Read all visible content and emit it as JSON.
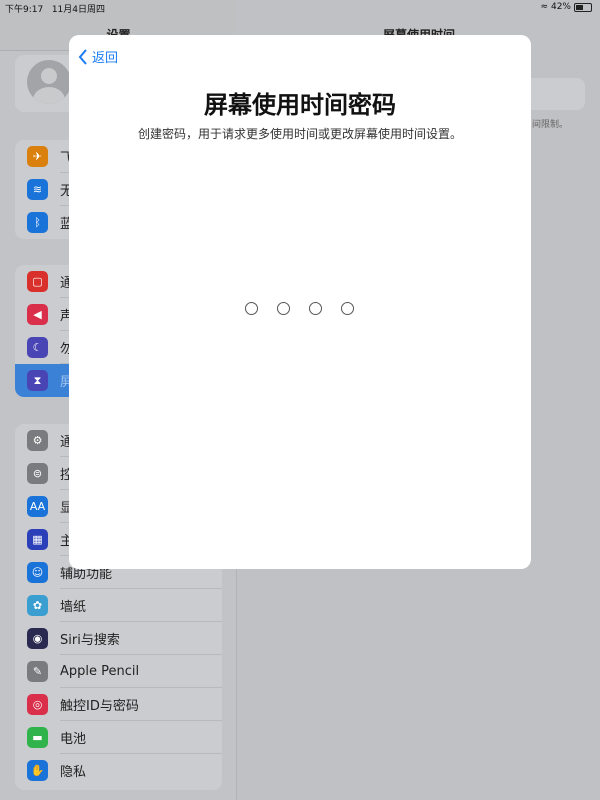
{
  "status_bar": {
    "time": "下午9:17",
    "date": "11月4日周四",
    "battery": "42%",
    "battery_level": 0.42
  },
  "sidebar": {
    "title": "设置",
    "groups": [
      [
        {
          "label": "飞",
          "icon": "airplane-icon",
          "color": "#d9800f"
        },
        {
          "label": "无",
          "icon": "wifi-icon",
          "color": "#1a73d9"
        },
        {
          "label": "蓝",
          "icon": "bluetooth-icon",
          "color": "#1a73d9"
        }
      ],
      [
        {
          "label": "通",
          "icon": "notifications-icon",
          "color": "#d9302c"
        },
        {
          "label": "声",
          "icon": "sound-icon",
          "color": "#d92f4b"
        },
        {
          "label": "勿",
          "icon": "moon-icon",
          "color": "#4a45b5"
        },
        {
          "label": "屏",
          "icon": "hourglass-icon",
          "color": "#4a45b5",
          "selected": true
        }
      ],
      [
        {
          "label": "通",
          "icon": "gear-icon",
          "color": "#7a7b7e"
        },
        {
          "label": "控",
          "icon": "toggles-icon",
          "color": "#7a7b7e"
        },
        {
          "label": "显",
          "icon": "display-icon",
          "color": "#1a73d9"
        },
        {
          "label": "主",
          "icon": "home-screen-icon",
          "color": "#2a3fb8"
        },
        {
          "label": "辅助功能",
          "icon": "accessibility-icon",
          "color": "#1a73d9"
        },
        {
          "label": "墙纸",
          "icon": "wallpaper-icon",
          "color": "#3a9fd0"
        },
        {
          "label": "Siri与搜索",
          "icon": "siri-icon",
          "color": "#2a2a50"
        },
        {
          "label": "Apple Pencil",
          "icon": "pencil-icon",
          "color": "#7a7b7e"
        },
        {
          "label": "触控ID与密码",
          "icon": "fingerprint-icon",
          "color": "#d92f4b"
        },
        {
          "label": "电池",
          "icon": "battery-icon",
          "color": "#2fb34a"
        },
        {
          "label": "隐私",
          "icon": "hand-icon",
          "color": "#1a73d9"
        }
      ]
    ]
  },
  "detail": {
    "title": "屏幕使用时间",
    "note": "间限制。"
  },
  "modal": {
    "back_label": "返回",
    "title": "屏幕使用时间密码",
    "subtitle": "创建密码，用于请求更多使用时间或更改屏幕使用时间设置。",
    "passcode_length": 4,
    "accent": "#1a7cf5"
  }
}
